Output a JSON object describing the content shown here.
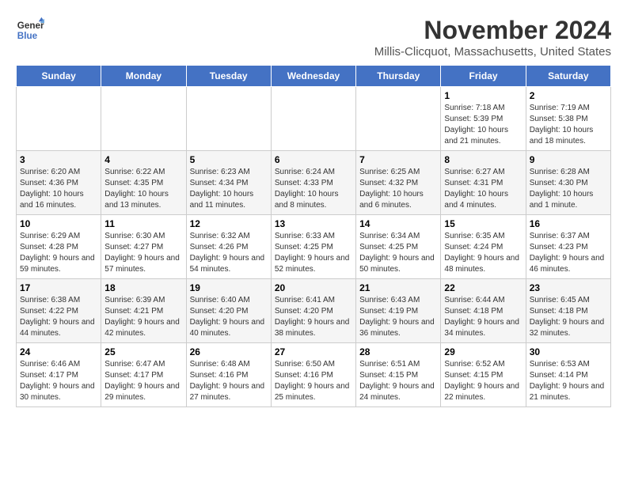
{
  "logo": {
    "line1": "General",
    "line2": "Blue"
  },
  "title": "November 2024",
  "location": "Millis-Clicquot, Massachusetts, United States",
  "days_of_week": [
    "Sunday",
    "Monday",
    "Tuesday",
    "Wednesday",
    "Thursday",
    "Friday",
    "Saturday"
  ],
  "weeks": [
    [
      {
        "day": "",
        "info": ""
      },
      {
        "day": "",
        "info": ""
      },
      {
        "day": "",
        "info": ""
      },
      {
        "day": "",
        "info": ""
      },
      {
        "day": "",
        "info": ""
      },
      {
        "day": "1",
        "info": "Sunrise: 7:18 AM\nSunset: 5:39 PM\nDaylight: 10 hours and 21 minutes."
      },
      {
        "day": "2",
        "info": "Sunrise: 7:19 AM\nSunset: 5:38 PM\nDaylight: 10 hours and 18 minutes."
      }
    ],
    [
      {
        "day": "3",
        "info": "Sunrise: 6:20 AM\nSunset: 4:36 PM\nDaylight: 10 hours and 16 minutes."
      },
      {
        "day": "4",
        "info": "Sunrise: 6:22 AM\nSunset: 4:35 PM\nDaylight: 10 hours and 13 minutes."
      },
      {
        "day": "5",
        "info": "Sunrise: 6:23 AM\nSunset: 4:34 PM\nDaylight: 10 hours and 11 minutes."
      },
      {
        "day": "6",
        "info": "Sunrise: 6:24 AM\nSunset: 4:33 PM\nDaylight: 10 hours and 8 minutes."
      },
      {
        "day": "7",
        "info": "Sunrise: 6:25 AM\nSunset: 4:32 PM\nDaylight: 10 hours and 6 minutes."
      },
      {
        "day": "8",
        "info": "Sunrise: 6:27 AM\nSunset: 4:31 PM\nDaylight: 10 hours and 4 minutes."
      },
      {
        "day": "9",
        "info": "Sunrise: 6:28 AM\nSunset: 4:30 PM\nDaylight: 10 hours and 1 minute."
      }
    ],
    [
      {
        "day": "10",
        "info": "Sunrise: 6:29 AM\nSunset: 4:28 PM\nDaylight: 9 hours and 59 minutes."
      },
      {
        "day": "11",
        "info": "Sunrise: 6:30 AM\nSunset: 4:27 PM\nDaylight: 9 hours and 57 minutes."
      },
      {
        "day": "12",
        "info": "Sunrise: 6:32 AM\nSunset: 4:26 PM\nDaylight: 9 hours and 54 minutes."
      },
      {
        "day": "13",
        "info": "Sunrise: 6:33 AM\nSunset: 4:25 PM\nDaylight: 9 hours and 52 minutes."
      },
      {
        "day": "14",
        "info": "Sunrise: 6:34 AM\nSunset: 4:25 PM\nDaylight: 9 hours and 50 minutes."
      },
      {
        "day": "15",
        "info": "Sunrise: 6:35 AM\nSunset: 4:24 PM\nDaylight: 9 hours and 48 minutes."
      },
      {
        "day": "16",
        "info": "Sunrise: 6:37 AM\nSunset: 4:23 PM\nDaylight: 9 hours and 46 minutes."
      }
    ],
    [
      {
        "day": "17",
        "info": "Sunrise: 6:38 AM\nSunset: 4:22 PM\nDaylight: 9 hours and 44 minutes."
      },
      {
        "day": "18",
        "info": "Sunrise: 6:39 AM\nSunset: 4:21 PM\nDaylight: 9 hours and 42 minutes."
      },
      {
        "day": "19",
        "info": "Sunrise: 6:40 AM\nSunset: 4:20 PM\nDaylight: 9 hours and 40 minutes."
      },
      {
        "day": "20",
        "info": "Sunrise: 6:41 AM\nSunset: 4:20 PM\nDaylight: 9 hours and 38 minutes."
      },
      {
        "day": "21",
        "info": "Sunrise: 6:43 AM\nSunset: 4:19 PM\nDaylight: 9 hours and 36 minutes."
      },
      {
        "day": "22",
        "info": "Sunrise: 6:44 AM\nSunset: 4:18 PM\nDaylight: 9 hours and 34 minutes."
      },
      {
        "day": "23",
        "info": "Sunrise: 6:45 AM\nSunset: 4:18 PM\nDaylight: 9 hours and 32 minutes."
      }
    ],
    [
      {
        "day": "24",
        "info": "Sunrise: 6:46 AM\nSunset: 4:17 PM\nDaylight: 9 hours and 30 minutes."
      },
      {
        "day": "25",
        "info": "Sunrise: 6:47 AM\nSunset: 4:17 PM\nDaylight: 9 hours and 29 minutes."
      },
      {
        "day": "26",
        "info": "Sunrise: 6:48 AM\nSunset: 4:16 PM\nDaylight: 9 hours and 27 minutes."
      },
      {
        "day": "27",
        "info": "Sunrise: 6:50 AM\nSunset: 4:16 PM\nDaylight: 9 hours and 25 minutes."
      },
      {
        "day": "28",
        "info": "Sunrise: 6:51 AM\nSunset: 4:15 PM\nDaylight: 9 hours and 24 minutes."
      },
      {
        "day": "29",
        "info": "Sunrise: 6:52 AM\nSunset: 4:15 PM\nDaylight: 9 hours and 22 minutes."
      },
      {
        "day": "30",
        "info": "Sunrise: 6:53 AM\nSunset: 4:14 PM\nDaylight: 9 hours and 21 minutes."
      }
    ]
  ]
}
